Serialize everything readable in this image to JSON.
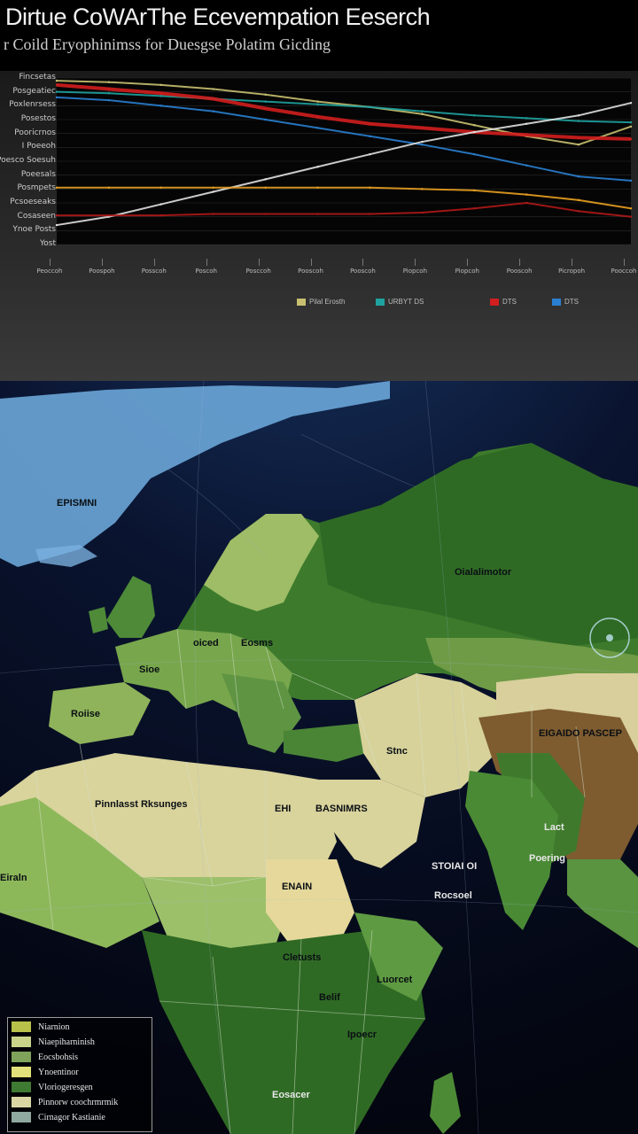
{
  "header": {
    "title": "Dirtue CoWArThe Ecevempation Eeserch",
    "subtitle": "r Coild Eryophinimss for Duesgse Polatim Gicding"
  },
  "chart_data": {
    "type": "line",
    "title": "",
    "y_tick_labels": [
      "Fincsetas",
      "Posgeatiec",
      "Poxlenrsess",
      "Posestos",
      "Pooricrnos",
      "I Poeeoh",
      "Poesco Soesuh",
      "Poeesals",
      "Posmpets",
      "Pcsoeseaks",
      "Cosaseen",
      "Ynoe Posts",
      "Yost"
    ],
    "x_tick_labels": [
      "Peoccoh",
      "Poospoh",
      "Posscoh",
      "Poscoh",
      "Posccoh",
      "Pooscoh",
      "Pooscoh",
      "Piopcoh",
      "Piopcoh",
      "Pooscoh",
      "Picropoh",
      "Pooccoh"
    ],
    "x": [
      0,
      1,
      2,
      3,
      4,
      5,
      6,
      7,
      8,
      9,
      10,
      11
    ],
    "ylim": [
      0,
      12
    ],
    "legend_placement": "bottom-right",
    "series": [
      {
        "name": "Pilal Erosth",
        "color": "#c8c070",
        "values": [
          11.8,
          11.7,
          11.5,
          11.2,
          10.8,
          10.3,
          9.9,
          9.4,
          8.6,
          7.8,
          7.2,
          8.5
        ]
      },
      {
        "name": "URBYT DS",
        "color": "#1fa3a0",
        "values": [
          11.0,
          10.9,
          10.7,
          10.5,
          10.3,
          10.1,
          9.9,
          9.6,
          9.3,
          9.1,
          8.9,
          8.8
        ]
      },
      {
        "name": "DTS",
        "color": "#d21e1e",
        "values": [
          11.5,
          11.2,
          10.9,
          10.5,
          9.8,
          9.2,
          8.7,
          8.4,
          8.1,
          7.9,
          7.7,
          7.6
        ]
      },
      {
        "name": "DTS",
        "color": "#2a7fd0",
        "values": [
          10.6,
          10.4,
          10.0,
          9.6,
          9.0,
          8.4,
          7.8,
          7.2,
          6.5,
          5.7,
          4.9,
          4.6
        ]
      },
      {
        "name": "",
        "color": "#e0e0e0",
        "values": [
          1.4,
          2.0,
          2.9,
          3.8,
          4.7,
          5.6,
          6.5,
          7.4,
          8.1,
          8.7,
          9.3,
          10.2
        ]
      },
      {
        "name": "",
        "color": "#e8a020",
        "values": [
          4.1,
          4.1,
          4.1,
          4.1,
          4.1,
          4.1,
          4.1,
          4.0,
          3.9,
          3.6,
          3.2,
          2.6
        ]
      },
      {
        "name": "",
        "color": "#b01818",
        "values": [
          2.1,
          2.1,
          2.1,
          2.2,
          2.2,
          2.2,
          2.2,
          2.3,
          2.6,
          3.0,
          2.4,
          2.0
        ]
      }
    ]
  },
  "map": {
    "labels": [
      {
        "text": "EPISMNI",
        "style": "dark"
      },
      {
        "text": "Oialalimotor",
        "style": "dark"
      },
      {
        "text": "oiced",
        "style": "dark"
      },
      {
        "text": "Eosms",
        "style": "dark"
      },
      {
        "text": "Sioe",
        "style": "dark"
      },
      {
        "text": "Roiise",
        "style": "dark"
      },
      {
        "text": "Pinnlasst Rksunges",
        "style": "dark"
      },
      {
        "text": "EHI",
        "style": "dark"
      },
      {
        "text": "BASNIMRS",
        "style": "dark"
      },
      {
        "text": "Stnc",
        "style": "dark"
      },
      {
        "text": "EIGAIDO PASCEP",
        "style": "dark"
      },
      {
        "text": "Lact",
        "style": "light"
      },
      {
        "text": "Poering",
        "style": "light"
      },
      {
        "text": "STOIAI OI",
        "style": "light"
      },
      {
        "text": "Rocsoel",
        "style": "light"
      },
      {
        "text": "Eiraln",
        "style": "dark"
      },
      {
        "text": "ENAIN",
        "style": "dark"
      },
      {
        "text": "Cletusts",
        "style": "dark"
      },
      {
        "text": "Belif",
        "style": "dark"
      },
      {
        "text": "Luorcet",
        "style": "dark"
      },
      {
        "text": "Ipoecr",
        "style": "dark"
      },
      {
        "text": "Eosacer",
        "style": "light"
      }
    ],
    "legend": [
      {
        "label": "Niarnion",
        "color": "#b8c24a"
      },
      {
        "label": "Niaepiharninish",
        "color": "#c9d48a"
      },
      {
        "label": "Eocsbohsis",
        "color": "#7fa35a"
      },
      {
        "label": "Ynoentinor",
        "color": "#e2e07a"
      },
      {
        "label": "Vloriogeresgen",
        "color": "#3f7a32"
      },
      {
        "label": "Pinnorw coochrmrmik",
        "color": "#d9d6a4"
      },
      {
        "label": "Cirnagor Kastianie",
        "color": "#8fa8a0"
      }
    ]
  }
}
